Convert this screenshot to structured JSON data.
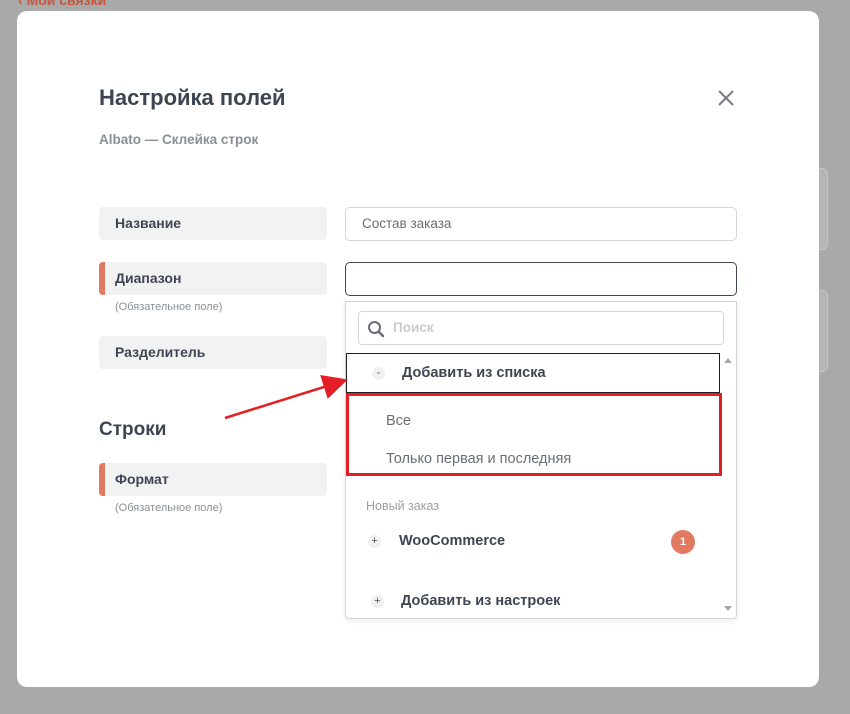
{
  "background": {
    "back_link": "Мои связки"
  },
  "modal": {
    "title": "Настройка полей",
    "subtitle": "Albato — Склейка строк"
  },
  "fields": [
    {
      "label": "Название",
      "required": false,
      "value": "Состав заказа"
    },
    {
      "label": "Диапазон",
      "required": true,
      "value": ""
    },
    {
      "label": "Разделитель",
      "required": false
    }
  ],
  "required_note": "(Обязательное поле)",
  "rows_section": {
    "title": "Строки",
    "fields": [
      {
        "label": "Формат",
        "required": true
      }
    ]
  },
  "dropdown": {
    "search_placeholder": "Поиск",
    "groups": [
      {
        "label": "Добавить из списка",
        "toggle": "-",
        "expanded": true,
        "options": [
          "Все",
          "Только первая и последняя"
        ]
      }
    ],
    "category": "Новый заказ",
    "items": [
      {
        "label": "WooCommerce",
        "toggle": "+",
        "badge": "1"
      },
      {
        "label": "Добавить из настроек",
        "toggle": "+"
      }
    ]
  },
  "colors": {
    "accent": "#e07a60",
    "annotation": "#e31e24",
    "text": "#3e4552"
  }
}
